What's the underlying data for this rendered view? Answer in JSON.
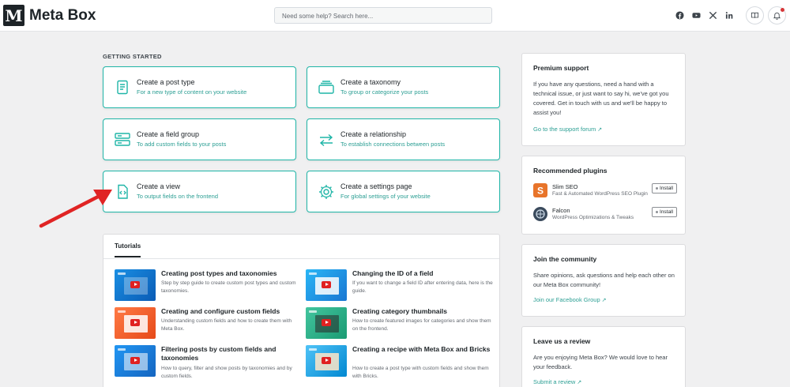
{
  "brand": {
    "mark": "M",
    "name": "Meta Box"
  },
  "header": {
    "search_placeholder": "Need some help? Search here...",
    "social_icons": [
      "facebook-icon",
      "youtube-icon",
      "x-icon",
      "linkedin-icon"
    ],
    "buttons": [
      "book-icon",
      "bell-icon"
    ]
  },
  "getting_started": {
    "label": "GETTING STARTED",
    "cards": [
      {
        "icon": "document-icon",
        "title": "Create a post type",
        "subtitle": "For a new type of content on your website"
      },
      {
        "icon": "taxonomy-icon",
        "title": "Create a taxonomy",
        "subtitle": "To group or categorize your posts"
      },
      {
        "icon": "field-group-icon",
        "title": "Create a field group",
        "subtitle": "To add custom fields to your posts"
      },
      {
        "icon": "relationship-icon",
        "title": "Create a relationship",
        "subtitle": "To establish connections between posts"
      },
      {
        "icon": "view-icon",
        "title": "Create a view",
        "subtitle": "To output fields on the frontend"
      },
      {
        "icon": "settings-icon",
        "title": "Create a settings page",
        "subtitle": "For global settings of your website"
      }
    ]
  },
  "tutorials": {
    "tab": "Tutorials",
    "items": [
      {
        "title": "Creating post types and taxonomies",
        "desc": "Step by step guide to create custom post types and custom taxonomies."
      },
      {
        "title": "Changing the ID of a field",
        "desc": "If you want to change a field ID after entering data, here is the guide."
      },
      {
        "title": "Creating and configure custom fields",
        "desc": "Understanding custom fields and how to create them with Meta Box."
      },
      {
        "title": "Creating category thumbnails",
        "desc": "How to create featured images for categories and show them on the frontend."
      },
      {
        "title": "Filtering posts by custom fields and taxonomies",
        "desc": "How to query, filter and show posts by taxonomies and by custom fields."
      },
      {
        "title": "Creating a recipe with Meta Box and Bricks",
        "desc": "How to create a post type with custom fields and show them with Bricks."
      }
    ]
  },
  "sidebar": {
    "premium": {
      "title": "Premium support",
      "body": "If you have any questions, need a hand with a technical issue, or just want to say hi, we've got you covered. Get in touch with us and we'll be happy to assist you!",
      "link": "Go to the support forum"
    },
    "plugins": {
      "title": "Recommended plugins",
      "items": [
        {
          "name": "Slim SEO",
          "desc": "Fast & Automated WordPress SEO Plugin",
          "button": "Install"
        },
        {
          "name": "Falcon",
          "desc": "WordPress Optimizations & Tweaks",
          "button": "Install"
        }
      ]
    },
    "community": {
      "title": "Join the community",
      "body": "Share opinions, ask questions and help each other on our Meta Box community!",
      "link": "Join our Facebook Group"
    },
    "review": {
      "title": "Leave us a review",
      "body": "Are you enjoying Meta Box? We would love to hear your feedback.",
      "link": "Submit a review"
    }
  },
  "colors": {
    "accent": "#1fb5a7",
    "link": "#2c9f94",
    "annotation_arrow": "#e02424"
  }
}
